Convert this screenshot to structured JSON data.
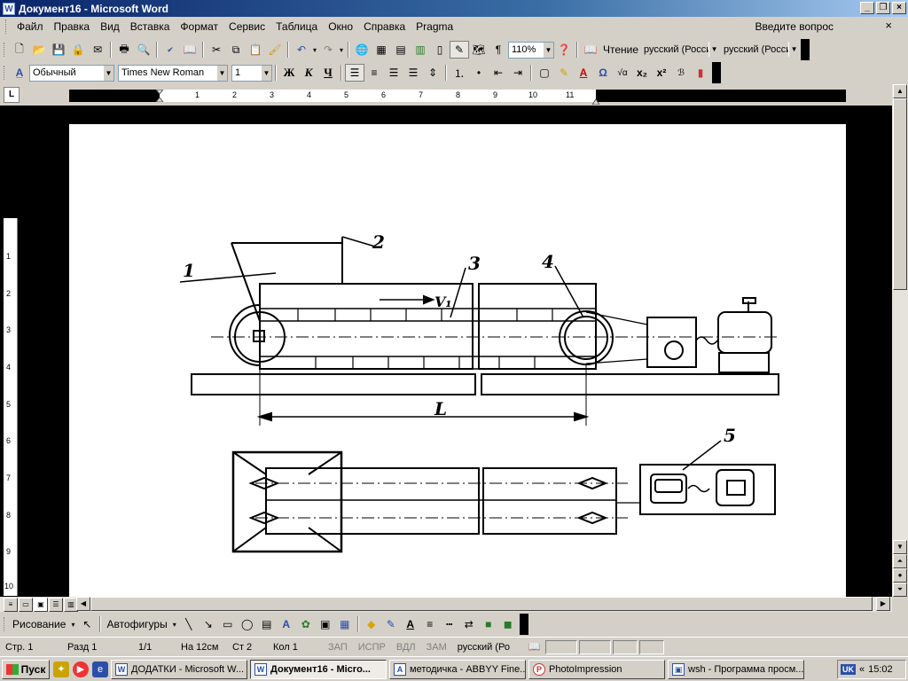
{
  "window": {
    "title": "Документ16 - Microsoft Word",
    "app_icon": "W"
  },
  "menu": {
    "items": [
      "Файл",
      "Правка",
      "Вид",
      "Вставка",
      "Формат",
      "Сервис",
      "Таблица",
      "Окно",
      "Справка",
      "Pragma"
    ],
    "question_placeholder": "Введите вопрос",
    "close_symbol": "×"
  },
  "standard_toolbar": {
    "zoom": "110%",
    "reading_label": "Чтение",
    "lang1": "русский (Росси",
    "lang2": "русский (Росси"
  },
  "format_toolbar": {
    "style": "Обычный",
    "font": "Times New Roman",
    "size": "1",
    "bold": "Ж",
    "italic": "К",
    "underline": "Ч"
  },
  "ruler": {
    "corner": "L",
    "h_ticks": [
      "1",
      "2",
      "3",
      "4",
      "5",
      "6",
      "7",
      "8",
      "9",
      "10",
      "11"
    ],
    "v_ticks": [
      "1",
      "2",
      "3",
      "4",
      "5",
      "6",
      "7",
      "8",
      "9",
      "10"
    ]
  },
  "drawing": {
    "labels": {
      "n1": "1",
      "n2": "2",
      "n3": "3",
      "n4": "4",
      "n5": "5",
      "velocity": "V₁",
      "length": "L"
    }
  },
  "draw_toolbar": {
    "draw_label": "Рисование",
    "autoshapes_label": "Автофигуры"
  },
  "status": {
    "page": "Стр. 1",
    "section": "Разд 1",
    "pages": "1/1",
    "at": "На 12см",
    "line": "Ст 2",
    "col": "Кол 1",
    "rec": "ЗАП",
    "trk": "ИСПР",
    "ext": "ВДЛ",
    "ovr": "ЗАМ",
    "lang": "русский (Ро"
  },
  "taskbar": {
    "start": "Пуск",
    "tasks": [
      {
        "label": "ДОДАТКИ - Microsoft W..."
      },
      {
        "label": "Документ16 - Micro..."
      },
      {
        "label": "методичка - ABBYY Fine..."
      },
      {
        "label": "PhotoImpression"
      },
      {
        "label": "wsh - Программа просм..."
      }
    ],
    "tray_lang": "UK",
    "tray_chevron": "«",
    "time": "15:02"
  }
}
